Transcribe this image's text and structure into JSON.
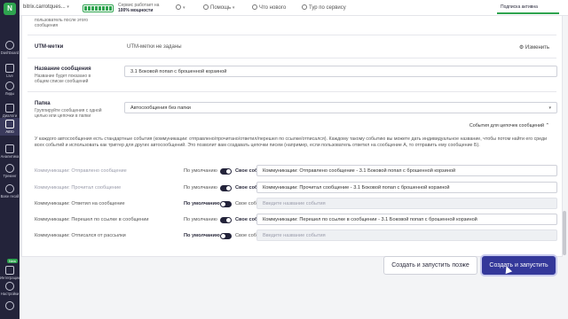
{
  "sidebar": {
    "items": [
      {
        "label": "Dashboard"
      },
      {
        "label": "Live"
      },
      {
        "label": "Лиды"
      },
      {
        "label": "Диалоги"
      },
      {
        "label": "Авто"
      },
      {
        "label": "Аналитика"
      },
      {
        "label": "Трекинг"
      },
      {
        "label": "Base recall"
      },
      {
        "label": "Интеграции"
      },
      {
        "label": "Настройки"
      }
    ],
    "new_badge": "New",
    "logo_text": "N"
  },
  "topbar": {
    "project": "bitrix.carrotques...",
    "project_arrow": "▾",
    "status_line1": "Сервис работает на",
    "status_line2": "100% мощности",
    "help": "Помощь",
    "help_arrow": "▾",
    "whats_new": "Что нового",
    "tour": "Тур по сервису",
    "subscription": "Подписка активна"
  },
  "form": {
    "top_hint_1": "пользователь после этого",
    "top_hint_2": "сообщения",
    "utm_label": "UTM-метки",
    "utm_value": "UTM-метки не заданы",
    "utm_edit": "⚙ Изменить",
    "name_label": "Название сообщения",
    "name_hint_1": "Название будет показано в",
    "name_hint_2": "общем списке сообщений",
    "name_value": "3.1 Боковой попап с брошенной корзиной",
    "folder_label": "Папка",
    "folder_hint_1": "Группируйте сообщения с одной",
    "folder_hint_2": "целью или цепочки в папки",
    "folder_value": "Автосообщения без папки",
    "folder_arrow": "▾",
    "chain_events": "События для цепочек сообщений ⌃",
    "note": "У каждого автосообщения есть стандартные события (коммуникации: отправлено/прочитано/ответил/перешел по ссылке/отписался). Каждому такому событию вы можете дать индивидуальное название, чтобы потом найти его среди всех событий и использовать как триггер для других автосообщений. Это позволит вам создавать цепочки писем (например, если пользователь ответил на сообщение А, то отправить ему сообщение Б)."
  },
  "events": [
    {
      "name": "Коммуникации: Отправлено сообщение",
      "default": "По умолчанию",
      "custom": "Свое событие",
      "value": "Коммуникации: Отправлено сообщение - 3.1 Боковой попап с брошенной корзиной",
      "placeholder": ""
    },
    {
      "name": "Коммуникации: Прочитал сообщение",
      "default": "По умолчанию",
      "custom": "Свое событие",
      "value": "Коммуникации: Прочитал сообщение - 3.1 Боковой попап с брошенной корзиной",
      "placeholder": ""
    },
    {
      "name": "Коммуникации: Ответил на сообщение",
      "default": "По умолчанию",
      "custom": "Свое событие",
      "value": "",
      "placeholder": "Введите название события"
    },
    {
      "name": "Коммуникации: Перешел по ссылке в сообщении",
      "default": "По умолчанию",
      "custom": "Свое событие",
      "value": "Коммуникации: Перешел по ссылке в сообщении - 3.1 Боковой попап с брошенной корзиной",
      "placeholder": ""
    },
    {
      "name": "Коммуникации: Отписался от рассылки",
      "default": "По умолчанию",
      "custom": "Свое событие",
      "value": "",
      "placeholder": "Введите название события"
    }
  ],
  "actions": {
    "create_and_start_later": "Создать и запустить позже",
    "create_and_start": "Создать и запустить"
  },
  "colors": {
    "accent": "#34389a",
    "sidebar": "#23233a",
    "status_green": "#2ea44f"
  }
}
